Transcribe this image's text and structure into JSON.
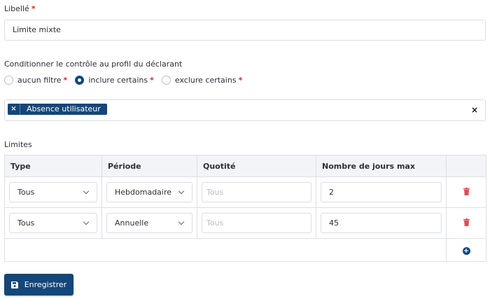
{
  "form": {
    "libelle_label": "Libellé",
    "required_mark": "*",
    "libelle_value": "Limite mixte",
    "profile_label": "Conditionner le contrôle au profil du déclarant",
    "radios": [
      {
        "label": "aucun filtre",
        "required": "*",
        "checked": false
      },
      {
        "label": "inclure certains",
        "required": "*",
        "checked": true
      },
      {
        "label": "exclure certains",
        "required": "*",
        "checked": false
      }
    ],
    "tag": {
      "remove": "×",
      "label": "Absence utilisateur"
    },
    "clear_all": "×",
    "limits_label": "Limites",
    "save_label": "Enregistrer"
  },
  "table": {
    "headers": [
      "Type",
      "Période",
      "Quotité",
      "Nombre de jours max"
    ],
    "rows": [
      {
        "type": "Tous",
        "periode": "Hebdomadaire",
        "quotite_placeholder": "Tous",
        "jours": "2"
      },
      {
        "type": "Tous",
        "periode": "Annuelle",
        "quotite_placeholder": "Tous",
        "jours": "45"
      }
    ],
    "add_icon": "+"
  },
  "colors": {
    "primary": "#14467a",
    "danger": "#e04b5a",
    "required": "#e02424",
    "header_bg": "#f3f4f7"
  },
  "icons": {
    "delete": "trash-icon",
    "add": "plus-circle-icon",
    "save": "floppy-disk-icon",
    "dropdown": "chevron-down-icon"
  }
}
